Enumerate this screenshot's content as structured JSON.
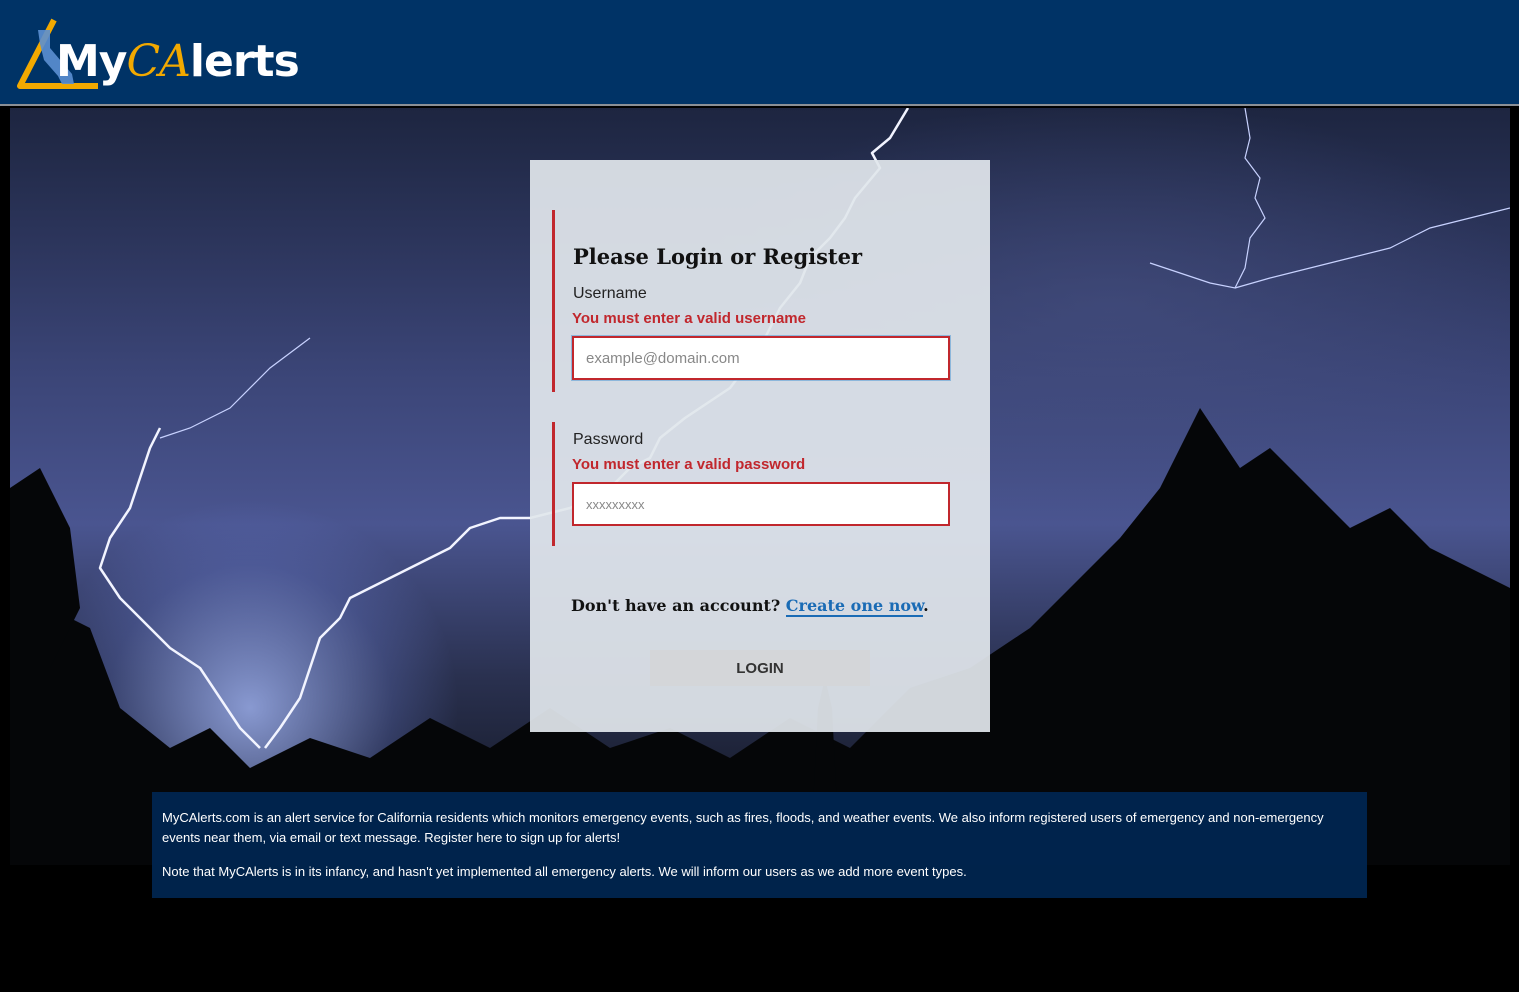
{
  "brand": {
    "logo_prefix": "My",
    "logo_ca": "CA",
    "logo_suffix": "lerts"
  },
  "login": {
    "title": "Please Login or Register",
    "username_label": "Username",
    "username_error": "You must enter a valid username",
    "username_placeholder": "example@domain.com",
    "password_label": "Password",
    "password_error": "You must enter a valid password",
    "password_placeholder": "xxxxxxxxx",
    "register_prompt": "Don't have an account?",
    "register_link": "Create one now",
    "register_suffix": ".",
    "login_button": "LOGIN"
  },
  "info": {
    "paragraph_1": "MyCAlerts.com is an alert service for California residents which monitors emergency events, such as fires, floods, and weather events. We also inform registered users of emergency and non-emergency events near them, via email or text message. Register here to sign up for alerts!",
    "paragraph_2": "Note that MyCAlerts is in its infancy, and hasn't yet implemented all emergency alerts. We will inform our users as we add more event types."
  },
  "colors": {
    "header_bg": "#003366",
    "logo_accent": "#f2a900",
    "error": "#c1272d",
    "link": "#1a6bb5"
  },
  "icons": {
    "logo_mark": "california-triangle-icon"
  }
}
